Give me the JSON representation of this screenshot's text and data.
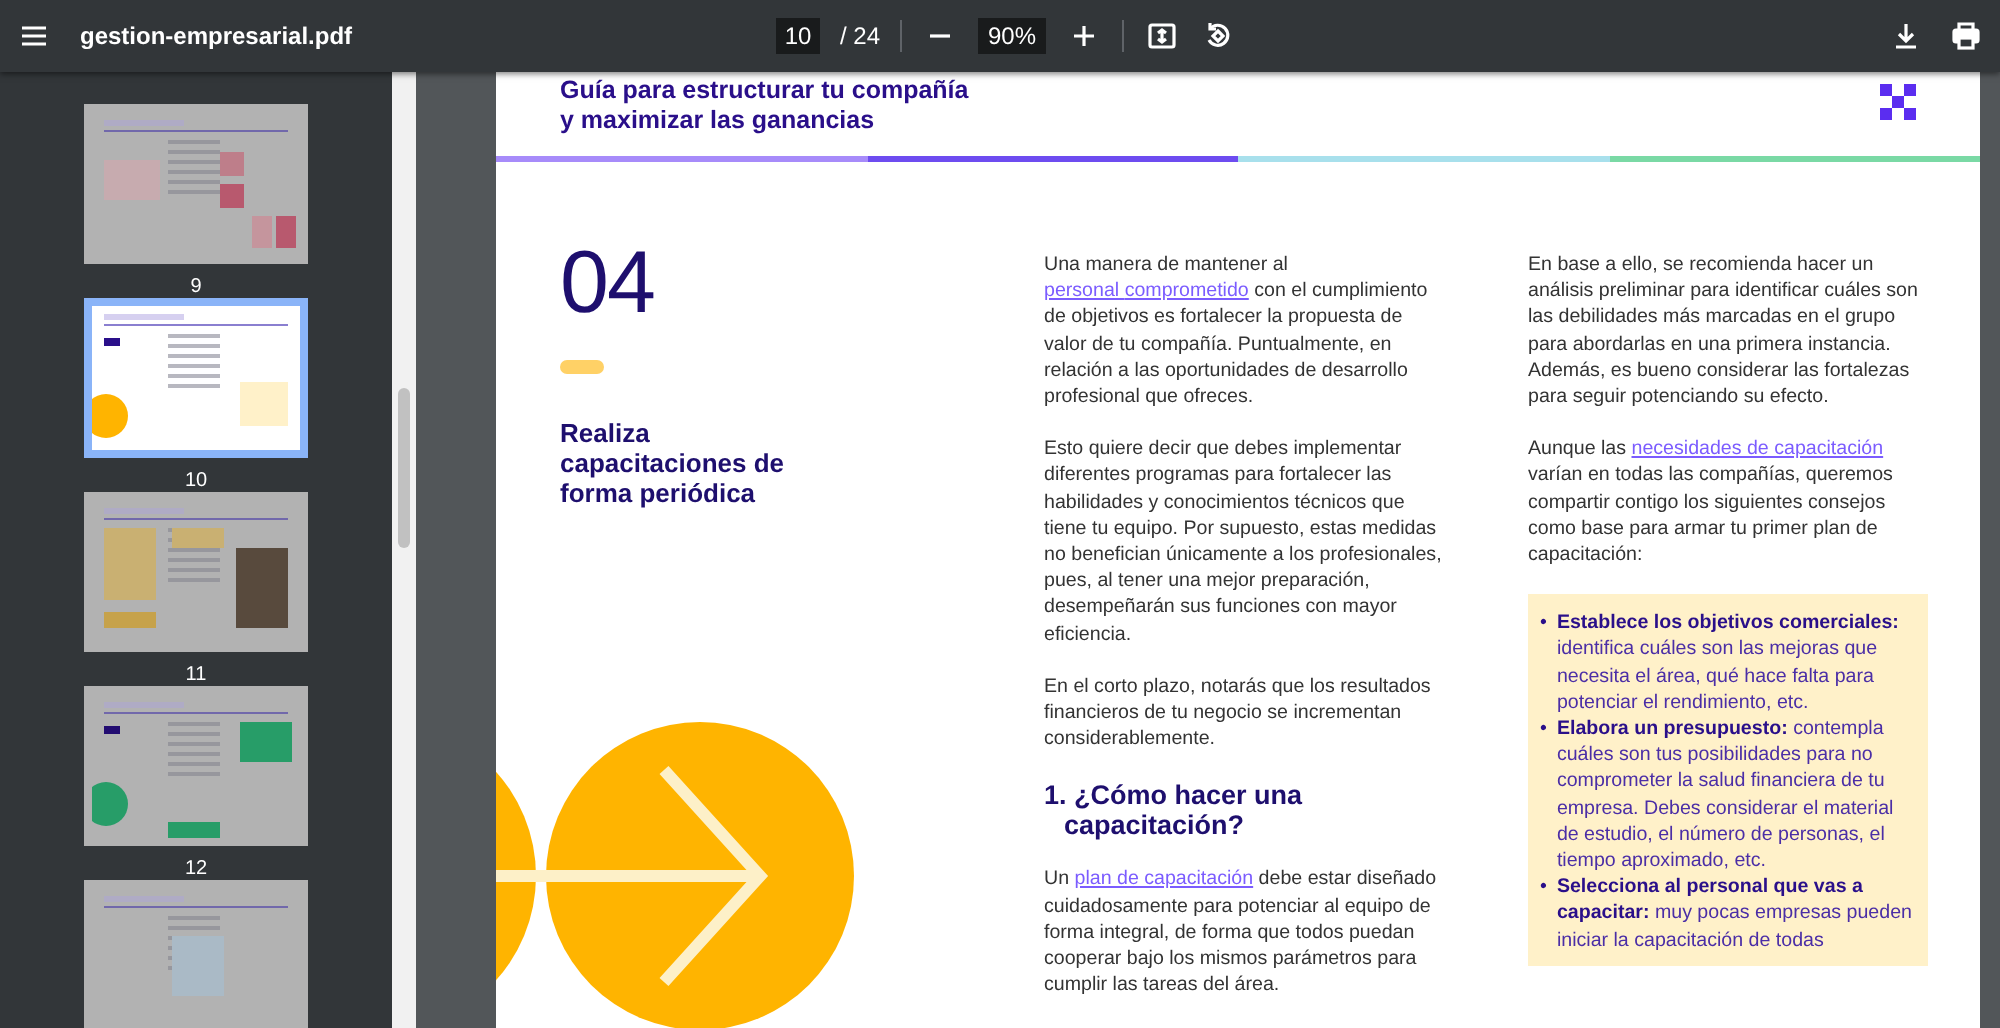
{
  "toolbar": {
    "file_name": "gestion-empresarial.pdf",
    "page_current": "10",
    "page_total": "/ 24",
    "zoom": "90%"
  },
  "sidebar": {
    "thumbnails": [
      {
        "label": "9",
        "selected": false,
        "kind": "pink"
      },
      {
        "label": "10",
        "selected": true,
        "kind": "yellow"
      },
      {
        "label": "11",
        "selected": false,
        "kind": "photo"
      },
      {
        "label": "12",
        "selected": false,
        "kind": "green"
      },
      {
        "selected": false,
        "kind": "blue"
      }
    ]
  },
  "page": {
    "title_lines": [
      "Guía para estructurar tu compañía",
      "y maximizar las ganancias"
    ],
    "number": "04",
    "heading": "Realiza capacitaciones de forma periódica",
    "column_2": [
      {
        "kind": "paragraph",
        "parts": [
          {
            "text": "Una manera de mantener al "
          },
          {
            "text": "personal ",
            "link": true
          },
          {
            "text": "comprometido",
            "link": true
          },
          {
            "text": " con el cumplimiento de objetivos es fortalecer la propuesta de valor de tu compañía. Puntualmente, en relación a las oportunidades de desarrollo profesional que ofreces."
          }
        ]
      },
      {
        "kind": "paragraph",
        "parts": [
          {
            "text": "Esto quiere decir que debes implementar diferentes programas para fortalecer las habilidades y conocimientos técnicos que tiene tu equipo. Por supuesto, estas medidas no benefician únicamente a los profesionales, pues, al tener una mejor preparación, desempeñarán sus funciones con mayor eficiencia."
          }
        ]
      },
      {
        "kind": "paragraph",
        "parts": [
          {
            "text": "En el corto plazo, notarás que los resultados financieros de tu negocio se incrementan considerablemente."
          }
        ]
      },
      {
        "kind": "heading",
        "text": "1. ¿Cómo hacer una capacitación?"
      },
      {
        "kind": "paragraph",
        "parts": [
          {
            "text": "Un "
          },
          {
            "text": "plan de capacitación",
            "link": true
          },
          {
            "text": " debe estar diseñado cuidadosamente para potenciar al equipo de forma integral, de forma que todos puedan cooperar bajo los mismos parámetros para cumplir las tareas del área."
          }
        ]
      }
    ],
    "column_3": [
      {
        "kind": "paragraph",
        "parts": [
          {
            "text": "En base a ello, se recomienda hacer un análisis preliminar para identificar cuáles son las debilidades más marcadas en el grupo para abordarlas en una primera instancia. Además, es bueno considerar las fortalezas para seguir potenciando su efecto."
          }
        ]
      },
      {
        "kind": "paragraph",
        "parts": [
          {
            "text": "Aunque las "
          },
          {
            "text": "necesidades de capacitación",
            "link": true
          },
          {
            "text": " varían en todas las compañías, queremos compartir contigo los siguientes consejos como base para armar tu primer plan de capacitación:"
          }
        ]
      },
      {
        "kind": "callout",
        "bullets": [
          {
            "marker": "•",
            "text": "**Establece los objetivos comerciales:** identifica cuáles son las mejoras que necesita el área, qué hace falta para potenciar el rendimiento, etc."
          },
          {
            "marker": "•",
            "text": "**Elabora un presupuesto:** contempla cuáles son tus posibilidades para no comprometer la salud financiera de tu empresa. Debes considerar el material de estudio, el número de personas, el tiempo aproximado, etc."
          },
          {
            "marker": "•",
            "text": "**Selecciona al personal que vas a capacitar:** muy pocas empresas pueden iniciar la capacitación de todas"
          }
        ]
      }
    ]
  }
}
